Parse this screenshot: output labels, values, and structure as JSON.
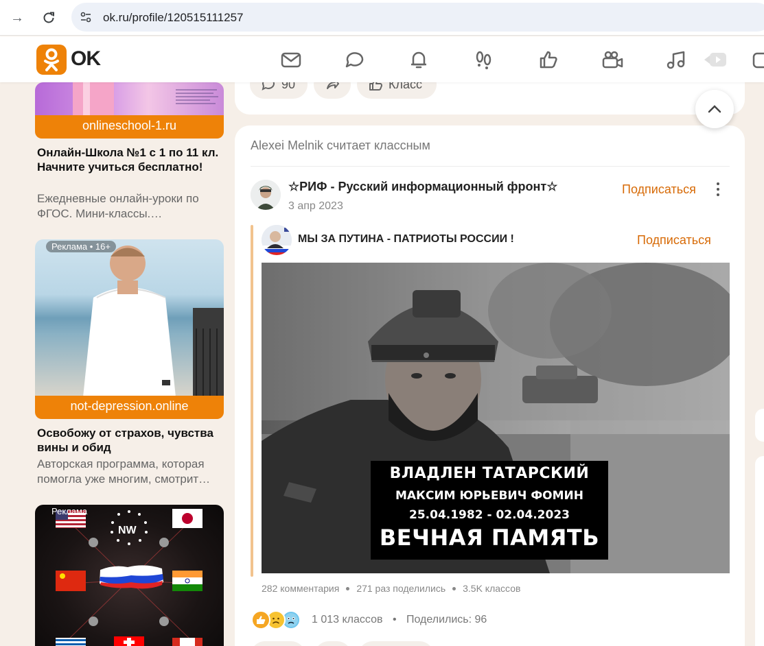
{
  "browser": {
    "url": "ok.ru/profile/120515111257"
  },
  "header": {
    "logo_text": "OK",
    "nav_icons": [
      "mail-icon",
      "discussions-icon",
      "notifications-icon",
      "guests-icon",
      "likes-icon",
      "video-icon",
      "music-icon",
      "videochannel-icon",
      "games-icon"
    ]
  },
  "ads": [
    {
      "domain": "onlineschool-1.ru",
      "title": "Онлайн-Школа №1 с 1 по 11 кл. Начните учиться бесплатно!",
      "desc": "Ежедневные онлайн-уроки по ФГОС. Мини-классы.…"
    },
    {
      "label": "Реклама • 16+",
      "domain": "not-depression.online",
      "title": "Освобожу от страхов, чувства вины и обид",
      "desc": "Авторская программа, которая помогла уже многим, смотрит…"
    },
    {
      "label": "Реклама",
      "badge": "NW"
    }
  ],
  "prev_post": {
    "comments": "90",
    "class_label": "Класс"
  },
  "post": {
    "liked_by": "Alexei Melnik считает классным",
    "group_name": "☆РИФ - Русский информационный фронт☆",
    "date": "3 апр 2023",
    "subscribe_label": "Подписаться",
    "repost": {
      "name": "МЫ ЗА ПУТИНА - ПАТРИОТЫ РОССИИ !",
      "subscribe_label": "Подписаться"
    },
    "caption": {
      "line1": "ВЛАДЛЕН ТАТАРСКИЙ",
      "line2": "МАКСИМ ЮРЬЕВИЧ ФОМИН",
      "line3": "25.04.1982 - 02.04.2023",
      "line4": "ВЕЧНАЯ ПАМЯТЬ"
    },
    "stats": {
      "comments": "282 комментария",
      "shares": "271 раз поделились",
      "classes": "3.5K классов"
    },
    "reactions": {
      "classes": "1 013 классов",
      "shared": "Поделились: 96",
      "separator": "•"
    }
  },
  "colors": {
    "accent": "#ee8208",
    "subscribe": "#d76a06",
    "page_bg": "#f6efe8"
  }
}
